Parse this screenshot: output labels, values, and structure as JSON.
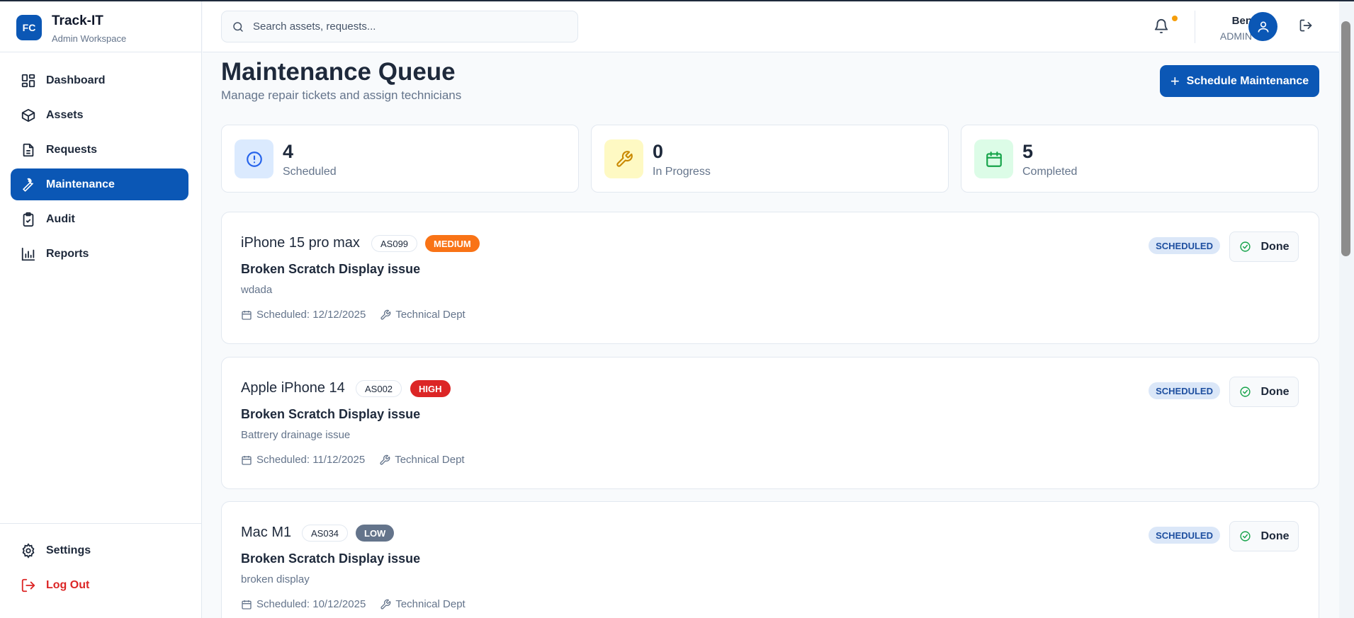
{
  "brand": {
    "logo_text": "FC",
    "title": "Track-IT",
    "subtitle": "Admin Workspace",
    "accent": "#0b57b5"
  },
  "sidebar": {
    "items": [
      {
        "label": "Dashboard",
        "icon": "dashboard-icon",
        "active": false
      },
      {
        "label": "Assets",
        "icon": "box-icon",
        "active": false
      },
      {
        "label": "Requests",
        "icon": "file-icon",
        "active": false
      },
      {
        "label": "Maintenance",
        "icon": "wrench-icon",
        "active": true
      },
      {
        "label": "Audit",
        "icon": "clipboard-check-icon",
        "active": false
      },
      {
        "label": "Reports",
        "icon": "bar-chart-icon",
        "active": false
      }
    ],
    "bottom": [
      {
        "label": "Settings",
        "icon": "gear-icon"
      },
      {
        "label": "Log Out",
        "icon": "logout-icon"
      }
    ]
  },
  "header": {
    "search_placeholder": "Search assets, requests...",
    "user_name": "Ben",
    "user_role": "ADMIN",
    "notification_dot_color": "#f59e0b"
  },
  "page": {
    "title": "Maintenance Queue",
    "subtitle": "Manage repair tickets and assign technicians",
    "primary_button": "Schedule Maintenance"
  },
  "stats": [
    {
      "value": "4",
      "label": "Scheduled",
      "icon": "alert-circle-icon",
      "color": "#2563eb",
      "bg": "#dbeafe"
    },
    {
      "value": "0",
      "label": "In Progress",
      "icon": "wrench-icon",
      "color": "#ca8a04",
      "bg": "#fef9c3"
    },
    {
      "value": "5",
      "label": "Completed",
      "icon": "calendar-icon",
      "color": "#16a34a",
      "bg": "#dcfce7"
    }
  ],
  "tickets": [
    {
      "asset_name": "iPhone 15 pro max",
      "asset_id": "AS099",
      "priority": "MEDIUM",
      "priority_color": "#f97316",
      "issue": "Broken Scratch Display issue",
      "description": "wdada",
      "scheduled": "Scheduled: 12/12/2025",
      "team": "Technical Dept",
      "status": "SCHEDULED",
      "action": "Done"
    },
    {
      "asset_name": "Apple iPhone 14",
      "asset_id": "AS002",
      "priority": "HIGH",
      "priority_color": "#dc2626",
      "issue": "Broken Scratch Display issue",
      "description": "Battrery drainage issue",
      "scheduled": "Scheduled: 11/12/2025",
      "team": "Technical Dept",
      "status": "SCHEDULED",
      "action": "Done"
    },
    {
      "asset_name": "Mac M1",
      "asset_id": "AS034",
      "priority": "LOW",
      "priority_color": "#64748b",
      "issue": "Broken Scratch Display issue",
      "description": "broken display",
      "scheduled": "Scheduled: 10/12/2025",
      "team": "Technical Dept",
      "status": "SCHEDULED",
      "action": "Done"
    }
  ]
}
